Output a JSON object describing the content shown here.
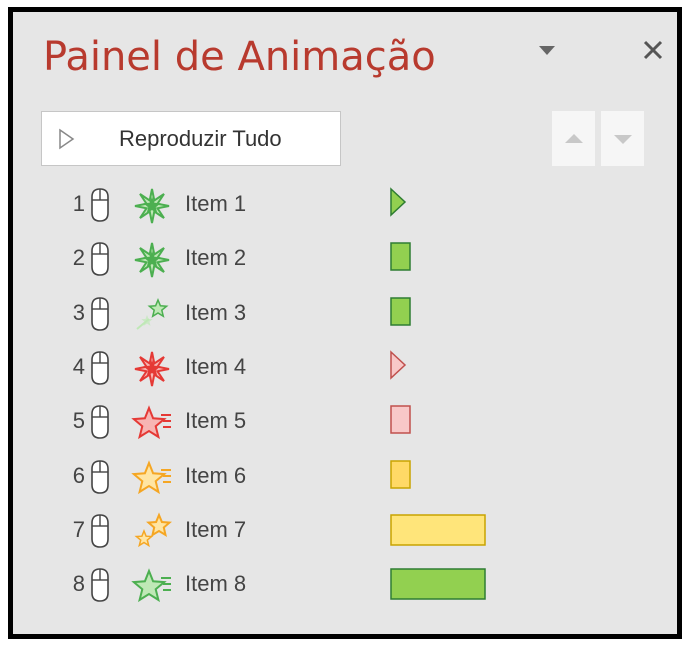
{
  "panel": {
    "title": "Painel de Animação",
    "play_all_label": "Reproduzir Tudo",
    "icons": {
      "menu": "chevron-down-icon",
      "close": "close-icon",
      "play": "play-icon",
      "move_up": "arrow-up-icon",
      "move_down": "arrow-down-icon",
      "trigger": "mouse-icon"
    }
  },
  "items": [
    {
      "num": "1",
      "label": "Item 1",
      "effect": "star-burst-icon",
      "effect_color": "#4caf50",
      "bar": "triangle",
      "bar_fill": "#92d050",
      "bar_stroke": "#2e7d32"
    },
    {
      "num": "2",
      "label": "Item 2",
      "effect": "star-burst-icon",
      "effect_color": "#4caf50",
      "bar": "rect-small",
      "bar_fill": "#92d050",
      "bar_stroke": "#2e7d32"
    },
    {
      "num": "3",
      "label": "Item 3",
      "effect": "fly-in-star-icon",
      "effect_color": "#4caf50",
      "bar": "rect-small",
      "bar_fill": "#92d050",
      "bar_stroke": "#2e7d32"
    },
    {
      "num": "4",
      "label": "Item 4",
      "effect": "star-burst-icon",
      "effect_color": "#e53935",
      "bar": "triangle",
      "bar_fill": "#f8c8c8",
      "bar_stroke": "#c0504d"
    },
    {
      "num": "5",
      "label": "Item 5",
      "effect": "star-wipe-icon",
      "effect_color": "#e53935",
      "bar": "rect-small",
      "bar_fill": "#f8c8c8",
      "bar_stroke": "#c0504d"
    },
    {
      "num": "6",
      "label": "Item 6",
      "effect": "star-wipe-icon",
      "effect_color": "#f5a623",
      "bar": "rect-small",
      "bar_fill": "#ffd966",
      "bar_stroke": "#c9a400"
    },
    {
      "num": "7",
      "label": "Item 7",
      "effect": "star-pair-icon",
      "effect_color": "#f5a623",
      "bar": "rect-long",
      "bar_fill": "#ffe57a",
      "bar_stroke": "#c9a400"
    },
    {
      "num": "8",
      "label": "Item 8",
      "effect": "star-wipe-icon",
      "effect_color": "#4caf50",
      "bar": "rect-long",
      "bar_fill": "#92d050",
      "bar_stroke": "#2e7d32"
    }
  ]
}
